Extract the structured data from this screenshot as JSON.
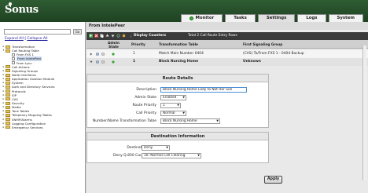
{
  "app": {
    "logo": "Sonus"
  },
  "tabs": [
    {
      "label": "Monitor"
    },
    {
      "label": "Tasks"
    },
    {
      "label": "Settings"
    },
    {
      "label": "Logs"
    },
    {
      "label": "System"
    }
  ],
  "left_panel": {
    "search_value": "",
    "go_label": "Go",
    "expand_all": "Expand All",
    "separator": "|",
    "collapse_all": "Collapse All",
    "items": [
      {
        "label": "Transformation",
        "depth": 0,
        "type": "folder",
        "expanded": false
      },
      {
        "label": "Call Routing Table",
        "depth": 0,
        "type": "folder",
        "expanded": true
      },
      {
        "label": "From FXS 1",
        "depth": 1,
        "type": "file"
      },
      {
        "label": "From IntelePeer",
        "depth": 1,
        "type": "file",
        "selected": true
      },
      {
        "label": "From Lync",
        "depth": 1,
        "type": "file"
      },
      {
        "label": "Call Actions",
        "depth": 0,
        "type": "folder"
      },
      {
        "label": "Signaling Groups",
        "depth": 0,
        "type": "folder"
      },
      {
        "label": "Node Interfaces",
        "depth": 0,
        "type": "folder"
      },
      {
        "label": "Application Solution Module",
        "depth": 0,
        "type": "folder"
      },
      {
        "label": "System",
        "depth": 0,
        "type": "folder"
      },
      {
        "label": "Auth and Directory Services",
        "depth": 0,
        "type": "folder"
      },
      {
        "label": "Protocols",
        "depth": 0,
        "type": "folder"
      },
      {
        "label": "SIP",
        "depth": 0,
        "type": "folder"
      },
      {
        "label": "CAS",
        "depth": 0,
        "type": "folder"
      },
      {
        "label": "Security",
        "depth": 0,
        "type": "folder"
      },
      {
        "label": "Media",
        "depth": 0,
        "type": "folder"
      },
      {
        "label": "Tone Tables",
        "depth": 0,
        "type": "folder"
      },
      {
        "label": "Telephony Mapping Tables",
        "depth": 0,
        "type": "folder"
      },
      {
        "label": "SNMP/Alarms",
        "depth": 0,
        "type": "folder"
      },
      {
        "label": "Logging Configuration",
        "depth": 0,
        "type": "folder"
      },
      {
        "label": "Emergency Services",
        "depth": 0,
        "type": "folder"
      }
    ]
  },
  "main": {
    "title": "From IntelePeer",
    "toolbar": {
      "display_counters": "Display Counters",
      "total_entries": "Total 2 Call Route Entry Rows"
    },
    "table": {
      "headers": {
        "admin_state_line1": "Admin",
        "admin_state_line2": "State",
        "priority": "Priority",
        "transformation_table": "Transformation Table",
        "first_signaling_group": "First Signaling Group"
      },
      "rows": [
        {
          "priority": "1",
          "transformation_table": "Match Main Number 0404",
          "first_signaling_group": "(CAS) To/From FXS 1 - 0404 Backup"
        },
        {
          "priority": "1",
          "transformation_table": "Block Nursing Home",
          "first_signaling_group": "Unknown"
        }
      ]
    }
  },
  "route_details": {
    "header": "Route Details",
    "description_label": "Description",
    "description_value": "Block Nursing Home Lady to Not Her Son",
    "admin_state_label": "Admin State",
    "admin_state_value": "Enabled",
    "route_priority_label": "Route Priority",
    "route_priority_value": "1",
    "call_priority_label": "Call Priority",
    "call_priority_value": "Normal",
    "transformation_label": "Number/Name Transformation Table",
    "transformation_value": "Block Nursing Home"
  },
  "destination": {
    "header": "Destination Information",
    "destination_type_label": "Destination Type",
    "destination_type_value": "Deny",
    "deny_cause_label": "Deny Q.850 Cause Code",
    "deny_cause_value": "16: Normal Call Clearing"
  },
  "apply_label": "Apply",
  "colors": {
    "header_green": "#1e4222",
    "toolbar_dark": "#3a3a3a",
    "focus_blue": "#4b8fd6"
  }
}
